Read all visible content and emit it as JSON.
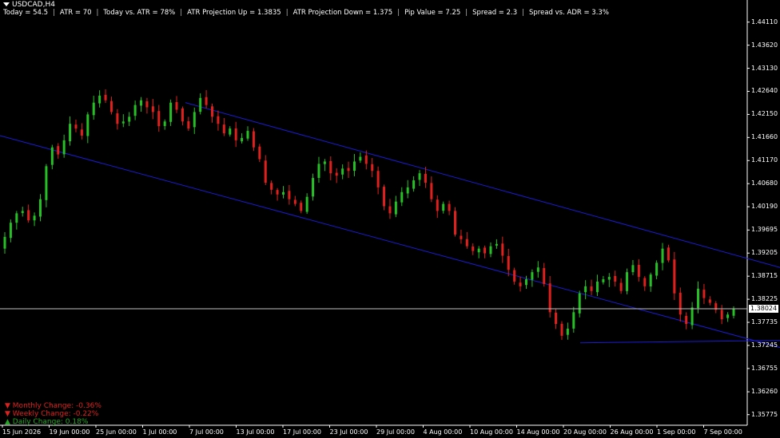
{
  "header": {
    "symbol": "USDCAD,H4"
  },
  "info_bar": {
    "items": [
      "Today = 54.5",
      "ATR = 70",
      "Today vs. ATR = 78%",
      "ATR Projection Up = 1.3835",
      "ATR Projection Down = 1.375",
      "Pip Value = 7.25",
      "Spread = 2.3",
      "Spread vs. ADR = 3.3%"
    ]
  },
  "changes": {
    "monthly": "Monthly Change: -0.36%",
    "weekly": "Weekly Change: -0.22%",
    "daily": "Daily Change: 0.18%"
  },
  "colors": {
    "background": "#000000",
    "bull": "#26c026",
    "bear": "#e0201c",
    "channel": "#1a1ad0",
    "current_line": "#c0c0c0",
    "axis_text": "#ffffff"
  },
  "chart_data": {
    "type": "candlestick",
    "timeframe": "H4",
    "ylim": [
      1.3555,
      1.4441
    ],
    "y_ticks": [
      "1.44110",
      "1.43620",
      "1.43130",
      "1.42640",
      "1.42150",
      "1.41660",
      "1.41170",
      "1.40680",
      "1.40190",
      "1.39695",
      "1.39205",
      "1.38715",
      "1.38225",
      "1.37735",
      "1.37245",
      "1.36755",
      "1.36260",
      "1.35775"
    ],
    "x_ticks": [
      "15 Jun 2026",
      "19 Jun 00:00",
      "25 Jun 00:00",
      "1 Jul 00:00",
      "7 Jul 00:00",
      "13 Jul 00:00",
      "17 Jul 00:00",
      "23 Jul 00:00",
      "29 Jul 00:00",
      "4 Aug 00:00",
      "10 Aug 00:00",
      "14 Aug 00:00",
      "20 Aug 00:00",
      "26 Aug 00:00",
      "1 Sep 00:00",
      "7 Sep 00:00"
    ],
    "current_price": "1.38024",
    "close_series": [
      1.3955,
      1.3985,
      1.4005,
      1.401,
      1.399,
      1.4,
      1.4035,
      1.4105,
      1.4145,
      1.413,
      1.416,
      1.4195,
      1.4185,
      1.417,
      1.4215,
      1.424,
      1.4255,
      1.4245,
      1.422,
      1.4195,
      1.42,
      1.421,
      1.4235,
      1.4245,
      1.423,
      1.422,
      1.419,
      1.42,
      1.424,
      1.4225,
      1.42,
      1.4185,
      1.422,
      1.425,
      1.4235,
      1.421,
      1.4195,
      1.4175,
      1.4185,
      1.416,
      1.4165,
      1.418,
      1.4145,
      1.412,
      1.407,
      1.4055,
      1.4045,
      1.405,
      1.4035,
      1.4025,
      1.401,
      1.404,
      1.408,
      1.411,
      1.4115,
      1.409,
      1.4085,
      1.41,
      1.4095,
      1.4115,
      1.4125,
      1.411,
      1.4095,
      1.406,
      1.402,
      1.4005,
      1.403,
      1.405,
      1.406,
      1.4075,
      1.409,
      1.407,
      1.4035,
      1.401,
      1.4025,
      1.401,
      1.396,
      1.395,
      1.3935,
      1.3925,
      1.393,
      1.392,
      1.3935,
      1.394,
      1.3915,
      1.3885,
      1.386,
      1.385,
      1.3865,
      1.388,
      1.389,
      1.3855,
      1.3795,
      1.377,
      1.3745,
      1.376,
      1.3795,
      1.3835,
      1.385,
      1.384,
      1.386,
      1.3865,
      1.387,
      1.386,
      1.384,
      1.388,
      1.3895,
      1.387,
      1.385,
      1.3875,
      1.39,
      1.393,
      1.3905,
      1.3835,
      1.379,
      1.377,
      1.3805,
      1.3845,
      1.3825,
      1.3815,
      1.38,
      1.378,
      1.379,
      1.3802
    ],
    "channel": {
      "upper": [
        {
          "date": "7 Jul",
          "price": 1.424
        },
        {
          "date": "9 Sep",
          "price": 1.389
        }
      ],
      "lower": [
        {
          "date": "15 Jun",
          "price": 1.417
        },
        {
          "date": "9 Sep",
          "price": 1.372
        }
      ],
      "base": [
        {
          "date": "20 Aug",
          "price": 1.373
        },
        {
          "date": "9 Sep",
          "price": 1.3735
        }
      ]
    },
    "grid": false,
    "legend": "none"
  }
}
